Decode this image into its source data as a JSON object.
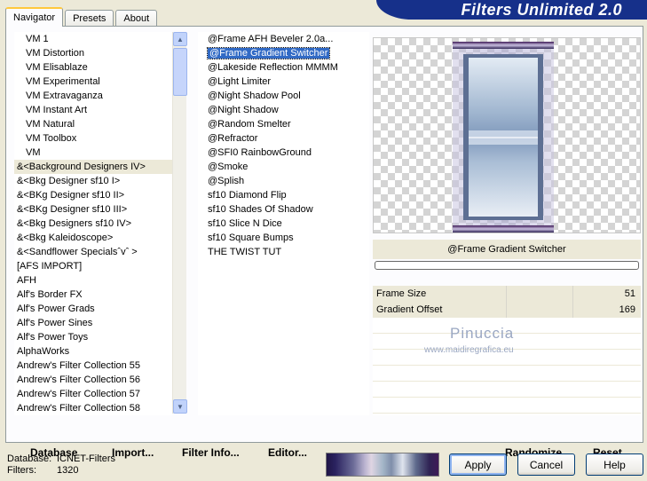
{
  "banner_title": "Filters Unlimited 2.0",
  "tabs": [
    {
      "label": "Navigator",
      "active": true
    },
    {
      "label": "Presets",
      "active": false
    },
    {
      "label": "About",
      "active": false
    }
  ],
  "categories": [
    "VM 1",
    "VM Distortion",
    "VM Elisablaze",
    "VM Experimental",
    "VM Extravaganza",
    "VM Instant Art",
    "VM Natural",
    "VM Toolbox",
    "VM",
    "&<Background Designers IV>",
    "&<Bkg Designer sf10 I>",
    "&<BKg Designer sf10 II>",
    "&<BKg Designer sf10 III>",
    "&<Bkg Designers sf10 IV>",
    "&<Bkg Kaleidoscope>",
    "&<Sandflower Specialsˆvˆ >",
    "[AFS IMPORT]",
    "AFH",
    "Alf's Border FX",
    "Alf's Power Grads",
    "Alf's Power Sines",
    "Alf's Power Toys",
    "AlphaWorks",
    "Andrew's Filter Collection 55",
    "Andrew's Filter Collection 56",
    "Andrew's Filter Collection 57",
    "Andrew's Filter Collection 58"
  ],
  "highlighted_category_index": 9,
  "filters": [
    "@Frame AFH Beveler 2.0a...",
    "@Frame Gradient Switcher",
    "@Lakeside Reflection MMMM",
    "@Light Limiter",
    "@Night Shadow Pool",
    "@Night Shadow",
    "@Random Smelter",
    "@Refractor",
    "@SFI0 RainbowGround",
    "@Smoke",
    "@Splish",
    "sf10 Diamond Flip",
    "sf10 Shades Of Shadow",
    "sf10 Slice N Dice",
    "sf10 Square Bumps",
    "THE TWIST TUT"
  ],
  "selected_filter_index": 1,
  "selected_filter_name": "@Frame Gradient Switcher",
  "parameters": [
    {
      "label": "Frame Size",
      "value": "51"
    },
    {
      "label": "Gradient Offset",
      "value": "169"
    }
  ],
  "watermark": {
    "line1": "Pinuccia",
    "line2": "www.maidiregrafica.eu"
  },
  "bottom_links": {
    "database": "Database",
    "import": "Import...",
    "filter_info": "Filter Info...",
    "editor": "Editor...",
    "randomize": "Randomize",
    "reset": "Reset"
  },
  "status": {
    "database_label": "Database:",
    "database_value": "ICNET-Filters",
    "filters_label": "Filters:",
    "filters_value": "1320"
  },
  "buttons": {
    "apply": "Apply",
    "cancel": "Cancel",
    "help": "Help"
  },
  "colors": {
    "selection": "#316ac5",
    "banner": "#16308a",
    "dialog_bg": "#ece9d8"
  }
}
